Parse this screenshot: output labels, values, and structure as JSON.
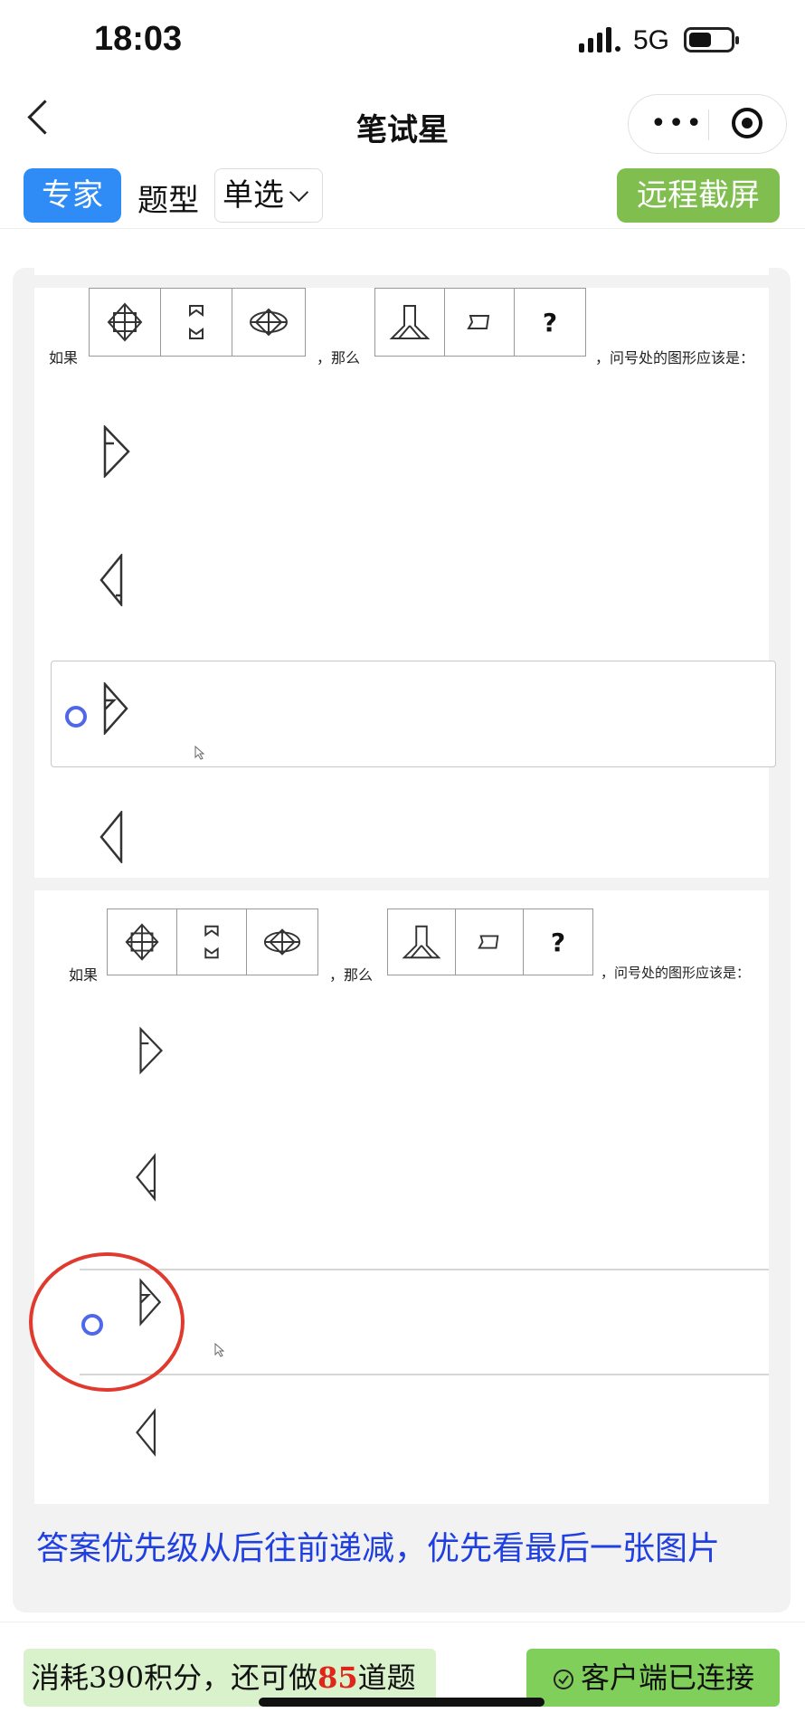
{
  "status_bar": {
    "time": "18:03",
    "network": "5G"
  },
  "nav": {
    "title": "笔试星",
    "more_glyph": "•••"
  },
  "toolbar": {
    "expert": "专家",
    "type_label": "题型",
    "type_value": "单选",
    "remote": "远程截屏"
  },
  "question": {
    "prefix": "如果",
    "middle": "，那么",
    "suffix": "，问号处的图形应该是：",
    "unknown": "?"
  },
  "hint": "答案优先级从后往前递减，优先看最后一张图片",
  "footer": {
    "credit_pre": "消耗390积分，还可做",
    "credit_num": "85",
    "credit_post": "道题",
    "connected": "客户端已连接"
  },
  "colors": {
    "accent_blue": "#2f8cf6",
    "green": "#7fbe4f",
    "radio": "#4f67e8",
    "highlight_red": "#e03a2e",
    "hint_blue": "#1f3fe0"
  },
  "icons": [
    "chevron-left-icon",
    "more-icon",
    "target-icon",
    "chevron-down-icon",
    "check-circle-icon"
  ]
}
